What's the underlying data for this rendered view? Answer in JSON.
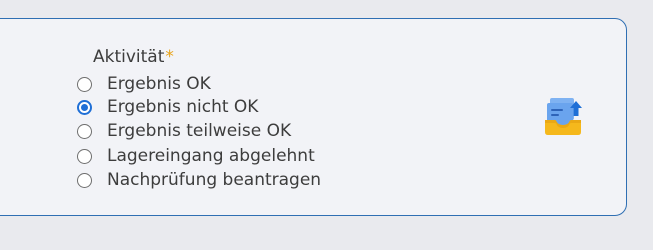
{
  "field": {
    "label": "Aktivität",
    "required_marker": "*"
  },
  "options": [
    {
      "label": "Ergebnis OK",
      "selected": false
    },
    {
      "label": "Ergebnis nicht OK",
      "selected": true
    },
    {
      "label": "Ergebnis teilweise OK",
      "selected": false
    },
    {
      "label": "Lagereingang abgelehnt",
      "selected": false
    },
    {
      "label": "Nachprüfung beantragen",
      "selected": false
    }
  ],
  "icon": {
    "name": "inbox-upload-icon"
  },
  "colors": {
    "accent": "#1f6fd6",
    "border": "#2f6fb3",
    "required": "#e8a317",
    "background": "#f2f3f7"
  }
}
